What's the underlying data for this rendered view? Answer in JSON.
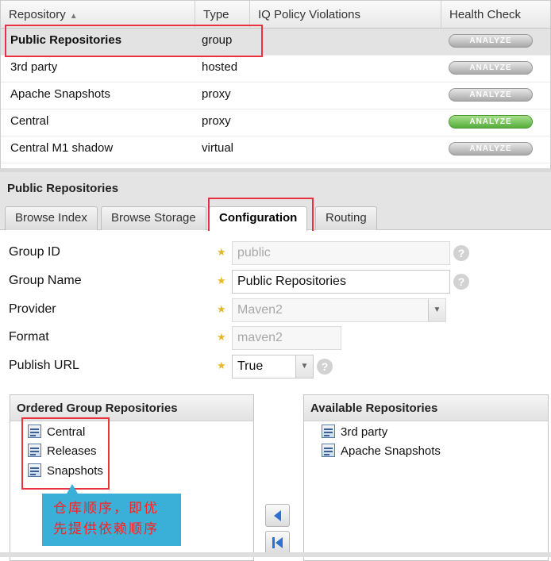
{
  "table": {
    "columns": {
      "repository": "Repository",
      "type": "Type",
      "iq": "IQ Policy Violations",
      "health": "Health Check"
    },
    "rows": [
      {
        "name": "Public Repositories",
        "type": "group",
        "analyze": "ANALYZE",
        "analyze_state": "grey",
        "selected": true
      },
      {
        "name": "3rd party",
        "type": "hosted",
        "analyze": "ANALYZE",
        "analyze_state": "grey"
      },
      {
        "name": "Apache Snapshots",
        "type": "proxy",
        "analyze": "ANALYZE",
        "analyze_state": "grey"
      },
      {
        "name": "Central",
        "type": "proxy",
        "analyze": "ANALYZE",
        "analyze_state": "green"
      },
      {
        "name": "Central M1 shadow",
        "type": "virtual",
        "analyze": "ANALYZE",
        "analyze_state": "grey"
      }
    ]
  },
  "detail": {
    "title": "Public Repositories",
    "tabs": [
      "Browse Index",
      "Browse Storage",
      "Configuration",
      "Routing"
    ],
    "active_tab": "Configuration"
  },
  "form": {
    "group_id": {
      "label": "Group ID",
      "value": "public"
    },
    "group_name": {
      "label": "Group Name",
      "value": "Public Repositories"
    },
    "provider": {
      "label": "Provider",
      "value": "Maven2"
    },
    "format": {
      "label": "Format",
      "value": "maven2"
    },
    "publish_url": {
      "label": "Publish URL",
      "value": "True"
    }
  },
  "ordered_repos": {
    "title": "Ordered Group Repositories",
    "items": [
      "Central",
      "Releases",
      "Snapshots"
    ]
  },
  "available_repos": {
    "title": "Available Repositories",
    "items": [
      "3rd party",
      "Apache Snapshots"
    ]
  },
  "annotation": {
    "line1": "仓库顺序，即优",
    "line2": "先提供依赖顺序"
  },
  "colors": {
    "highlight_box": "#e8333f",
    "callout_bg": "#3ab0d8",
    "callout_text": "#ff2020",
    "analyze_green": "#55ad3a",
    "required_star": "#e7b928"
  }
}
